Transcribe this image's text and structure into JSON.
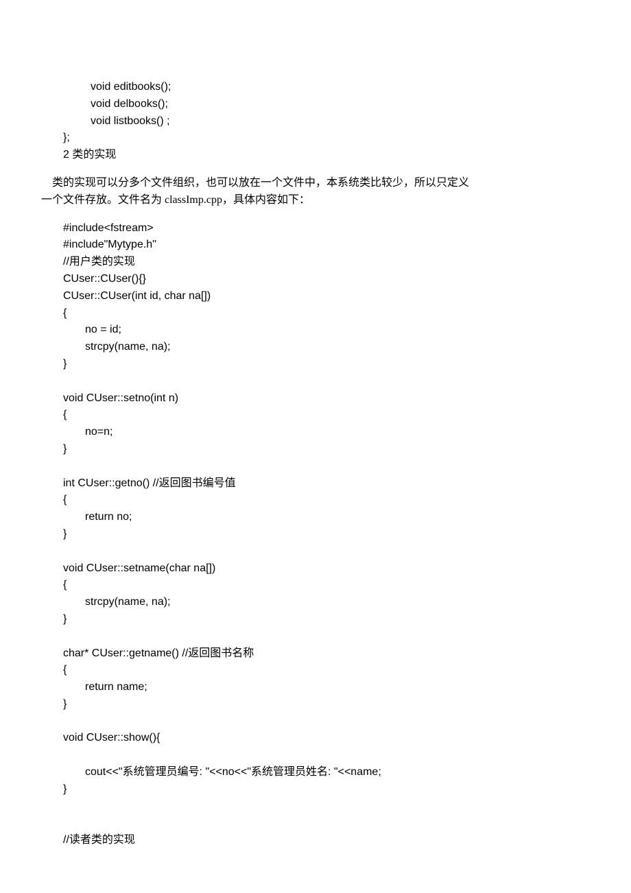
{
  "lines": [
    {
      "cls": "code code-i4",
      "text": "void editbooks();"
    },
    {
      "cls": "code code-i4",
      "text": "void delbooks();"
    },
    {
      "cls": "code code-i4",
      "text": "void listbooks() ;"
    },
    {
      "cls": "code",
      "text": "};"
    },
    {
      "cls": "code",
      "text": "2 类的实现"
    },
    {
      "cls": "nowrap",
      "text": "    类的实现可以分多个文件组织，也可以放在一个文件中，本系统类比较少，所以只定义\n一个文件存放。文件名为 classImp.cpp，具体内容如下："
    },
    {
      "cls": "code",
      "text": "#include<fstream>"
    },
    {
      "cls": "code",
      "text": "#include\"Mytype.h\""
    },
    {
      "cls": "code",
      "text": "//用户类的实现"
    },
    {
      "cls": "code",
      "text": "CUser::CUser(){}"
    },
    {
      "cls": "code",
      "text": "CUser::CUser(int id, char na[])"
    },
    {
      "cls": "code",
      "text": "{"
    },
    {
      "cls": "code code-i3",
      "text": "no = id;"
    },
    {
      "cls": "code code-i3",
      "text": "strcpy(name, na);"
    },
    {
      "cls": "code",
      "text": "}"
    },
    {
      "cls": "code",
      "text": " "
    },
    {
      "cls": "code",
      "text": "void CUser::setno(int n)"
    },
    {
      "cls": "code",
      "text": "{"
    },
    {
      "cls": "code code-i3",
      "text": "no=n;"
    },
    {
      "cls": "code",
      "text": "}"
    },
    {
      "cls": "code",
      "text": " "
    },
    {
      "cls": "code",
      "text": "int CUser::getno() //返回图书编号值"
    },
    {
      "cls": "code",
      "text": "{"
    },
    {
      "cls": "code code-i3",
      "text": "return no;"
    },
    {
      "cls": "code",
      "text": "}"
    },
    {
      "cls": "code",
      "text": " "
    },
    {
      "cls": "code",
      "text": "void CUser::setname(char na[])"
    },
    {
      "cls": "code",
      "text": "{"
    },
    {
      "cls": "code code-i3",
      "text": "strcpy(name, na);"
    },
    {
      "cls": "code",
      "text": "}"
    },
    {
      "cls": "code",
      "text": " "
    },
    {
      "cls": "code",
      "text": "char* CUser::getname()   //返回图书名称"
    },
    {
      "cls": "code",
      "text": "{"
    },
    {
      "cls": "code code-i3",
      "text": " return name;"
    },
    {
      "cls": "code",
      "text": "}"
    },
    {
      "cls": "code",
      "text": " "
    },
    {
      "cls": "code",
      "text": "void CUser::show(){"
    },
    {
      "cls": "code",
      "text": " "
    },
    {
      "cls": "code code-i3",
      "text": "cout<<\"系统管理员编号:   \"<<no<<\"系统管理员姓名:   \"<<name;"
    },
    {
      "cls": "code",
      "text": "}"
    },
    {
      "cls": "code",
      "text": " "
    },
    {
      "cls": "code",
      "text": " "
    },
    {
      "cls": "code",
      "text": "//读者类的实现"
    }
  ]
}
